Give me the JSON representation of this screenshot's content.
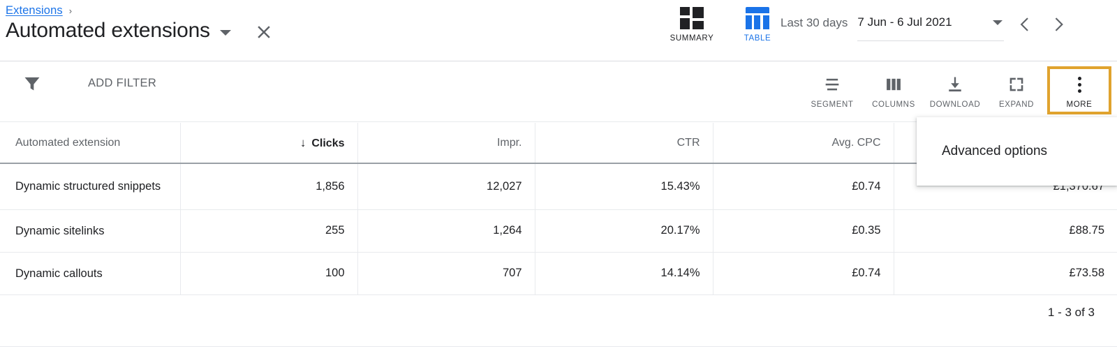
{
  "header": {
    "breadcrumb_link": "Extensions",
    "breadcrumb_separator": "›",
    "page_title": "Automated extensions",
    "title_caret_icon": "chevron-down-icon",
    "close_icon": "close-icon",
    "view_toggles": [
      {
        "label": "SUMMARY",
        "icon": "summary-grid-icon",
        "active": false
      },
      {
        "label": "TABLE",
        "icon": "table-icon",
        "active": true
      }
    ],
    "date": {
      "preset": "Last 30 days",
      "range": "7 Jun - 6 Jul 2021",
      "caret_icon": "chevron-down-icon",
      "prev_icon": "chevron-left-icon",
      "next_icon": "chevron-right-icon"
    }
  },
  "toolbar": {
    "filter_icon": "funnel-icon",
    "add_filter_label": "ADD FILTER",
    "actions": [
      {
        "label": "SEGMENT",
        "icon": "segment-icon",
        "highlighted": false
      },
      {
        "label": "COLUMNS",
        "icon": "columns-icon",
        "highlighted": false
      },
      {
        "label": "DOWNLOAD",
        "icon": "download-icon",
        "highlighted": false
      },
      {
        "label": "EXPAND",
        "icon": "expand-icon",
        "highlighted": false
      },
      {
        "label": "MORE",
        "icon": "more-vert-icon",
        "highlighted": true
      }
    ],
    "segment_label": "SEGMENT",
    "columns_label": "COLUMNS",
    "download_label": "DOWNLOAD",
    "expand_label": "EXPAND",
    "more_label": "MORE"
  },
  "menu": {
    "open": true,
    "items": [
      "Advanced options"
    ],
    "advanced_options_label": "Advanced options"
  },
  "table": {
    "sort_column": "Clicks",
    "sort_direction": "desc",
    "sort_arrow_glyph": "↓",
    "columns": [
      "Automated extension",
      "Clicks",
      "Impr.",
      "CTR",
      "Avg. CPC",
      ""
    ],
    "rows": [
      {
        "name": "Dynamic structured snippets",
        "clicks": "1,856",
        "impr": "12,027",
        "ctr": "15.43%",
        "avg_cpc": "£0.74",
        "cost": "£1,370.67"
      },
      {
        "name": "Dynamic sitelinks",
        "clicks": "255",
        "impr": "1,264",
        "ctr": "20.17%",
        "avg_cpc": "£0.35",
        "cost": "£88.75"
      },
      {
        "name": "Dynamic callouts",
        "clicks": "100",
        "impr": "707",
        "ctr": "14.14%",
        "avg_cpc": "£0.74",
        "cost": "£73.58"
      }
    ],
    "pagination": "1 - 3 of 3"
  },
  "colors": {
    "accent_blue": "#1a73e8",
    "highlight_gold": "#e0a32e",
    "text_primary": "#202124",
    "text_secondary": "#5f6368",
    "border": "#e8eaed"
  }
}
